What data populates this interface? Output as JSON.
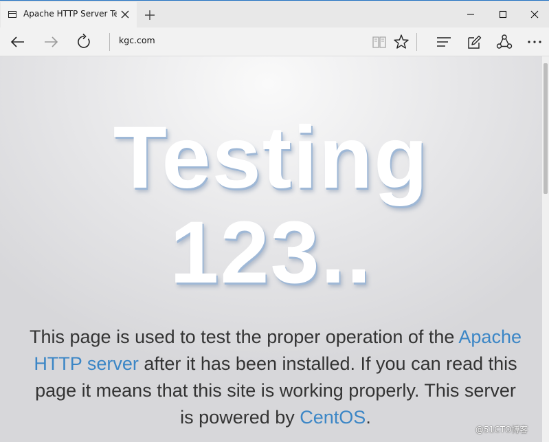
{
  "tab": {
    "title": "Apache HTTP Server Tes"
  },
  "address_bar": {
    "url": "kgc.com"
  },
  "page": {
    "headline_line1": "Testing",
    "headline_line2": "123..",
    "paragraph": {
      "text1": "This page is used to test the proper operation of the ",
      "link1": "Apache HTTP server",
      "text2": " after it has been installed. If you can read this page it means that this site is working properly. This server is powered by ",
      "link2": "CentOS",
      "text3": "."
    }
  },
  "watermark": "@51CTO博客",
  "colors": {
    "link": "#3b86c6",
    "body_text": "#333333",
    "window_accent": "#1f70c1"
  },
  "icons": {
    "tab_favicon": "page-icon",
    "tab_close": "close-icon",
    "new_tab": "plus-icon",
    "back": "back-arrow-icon",
    "forward": "forward-arrow-icon",
    "refresh": "refresh-icon",
    "reading_view": "book-icon",
    "favorite": "star-icon",
    "hub": "hub-icon",
    "web_note": "pen-note-icon",
    "share": "share-icon",
    "more": "more-icon"
  }
}
